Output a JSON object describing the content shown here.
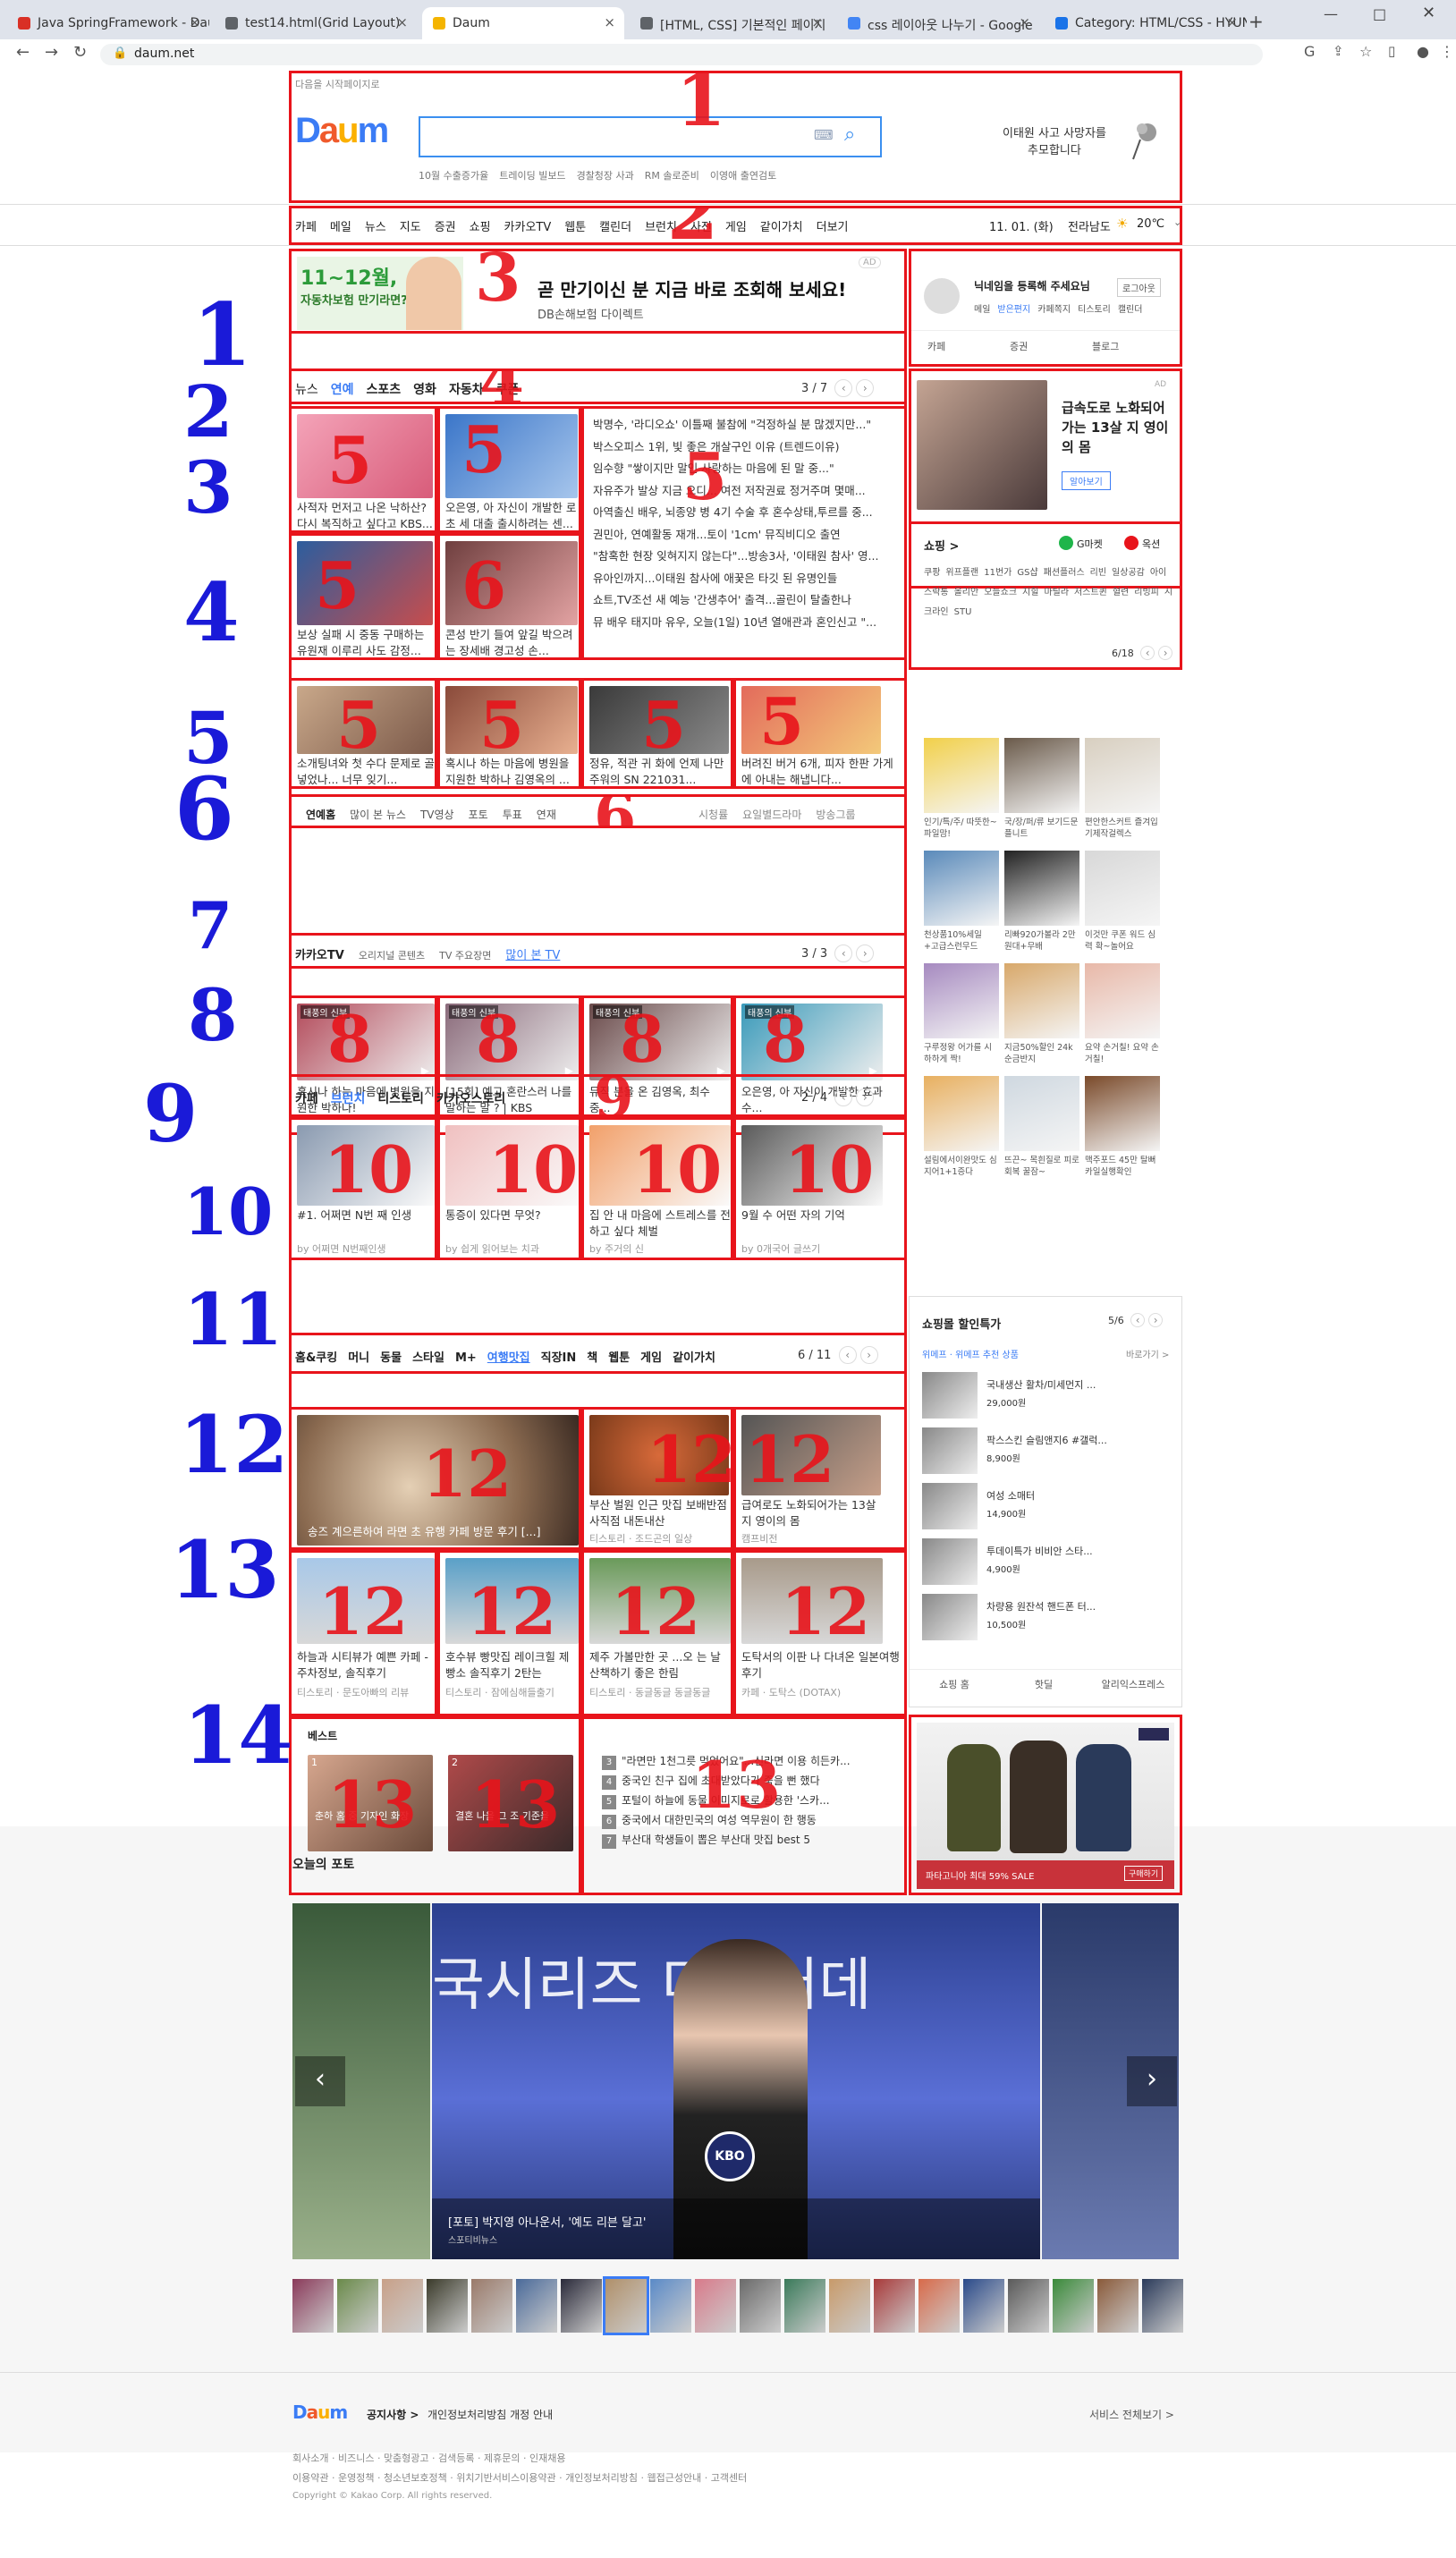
{
  "browser": {
    "tabs": [
      {
        "title": "Java SpringFramework - Daum",
        "color": "#d93025"
      },
      {
        "title": "test14.html(Grid Layout)",
        "color": "#5f6368"
      },
      {
        "title": "Daum",
        "color": "#f4b400"
      },
      {
        "title": "[HTML, CSS] 기본적인 페이지",
        "color": "#5f6368"
      },
      {
        "title": "css 레이아웃 나누기 - Google",
        "color": "#4285f4"
      },
      {
        "title": "Category: HTML/CSS - HYUN",
        "color": "#1a73e8"
      }
    ],
    "url": "daum.net",
    "new_tab": "+"
  },
  "header": {
    "start_link": "다음을 시작페이지로",
    "logo": "Daum",
    "trending": [
      "10월 수출증가율",
      "트레이딩 빌보드",
      "경찰청장 사과",
      "RM 솔로준비",
      "이영애 출연검토"
    ],
    "memorial": [
      "이태원 사고 사망자를",
      "추모합니다"
    ]
  },
  "gnb": {
    "items": [
      "카페",
      "메일",
      "뉴스",
      "지도",
      "증권",
      "쇼핑",
      "카카오TV",
      "웹툰",
      "캘린더",
      "브런치",
      "사전",
      "게임",
      "같이가치",
      "더보기"
    ],
    "date": "11. 01. (화)",
    "region": "전라남도",
    "temp": "20℃"
  },
  "ad_banner": {
    "badge_line1": "11~12월,",
    "badge_line2": "자동차보험 만기라면?",
    "title": "곧 만기이신 분 지금 바로 조회해 보세요!",
    "sub": "DB손해보험 다이렉트",
    "ad": "AD"
  },
  "news_tabs": {
    "items": [
      "뉴스",
      "연예",
      "스포츠",
      "영화",
      "자동차",
      "쿠폰"
    ],
    "page": "3 / 7"
  },
  "news_cards_row1": [
    {
      "text": "사적자 먼저고 나온 낙하산? 다시 복직하고 싶다고 KBS..."
    },
    {
      "text": "오은영, 아 자신이 개발한 로 초 세 대출 출시하려는 센..."
    }
  ],
  "news_cards_row2": [
    {
      "text": "보상 실패 시 중동 구매하는 유원재 이루리 사도 감정..."
    },
    {
      "text": "콘성 반기 들여 앞길 박으려는 장세배 경고성 손..."
    }
  ],
  "news_list": [
    "박명수, '라디오쇼' 이틀째 불참에 \"걱정하실 분 많겠지만...\"",
    "박스오피스 1위, 빛 좋은 개살구인 이유 (트렌드이유)",
    "임수향 \"쌓이지만 말인 사랑하는 마음에 된 말 중...\"",
    "자유주가 발상 지금 오디... 여전 저작권료 정거주며 몇매...",
    "아역출신 배우, 뇌종양 병 4기 수술 후 혼수상태,투르를 중...",
    "권민아, 연예활동 재개...토이 '1cm' 뮤직비디오 출연",
    "\"참혹한 현장 잊혀지지 않는다\"...방송3사, '이태원 참사' 영...",
    "유아인까지...이태원 참사에 애꿎은 타깃 된 유명인들",
    "쇼트,TV조선 새 예능 '간생추어' 출격...골린이 탈출한나",
    "뮤 배우 태지마 유우, 오늘(1일) 10년 열애관과 혼인신고 \"..."
  ],
  "news_cards_row3": [
    {
      "text": "소개팅녀와 첫 수다 문제로 골넣었나... 너무 잊기..."
    },
    {
      "text": "혹시나 하는 마음에 병원을 지원한 박하나 김영옥의 ..."
    },
    {
      "text": "정유, 적관 귀 화에 언제 나만 주워의 SN 221031..."
    },
    {
      "text": "버려진 버거 6개, 피자 한판 가게에 아내는 해냅니다..."
    }
  ],
  "ent_subtabs": {
    "items": [
      "연예홈",
      "많이 본 뉴스",
      "TV영상",
      "포토",
      "투표",
      "연재"
    ],
    "right": [
      "시청률",
      "요일별드라마",
      "방송그룹"
    ]
  },
  "kakaotv": {
    "tabs": [
      "카카오TV",
      "오리지널 콘텐츠",
      "TV 주요장면",
      "많이 본 TV"
    ],
    "page": "3 / 3",
    "cards": [
      {
        "tag": "태풍의 신부",
        "text": "혹시나 하는 마음에 병원을 지원한 박하나!"
      },
      {
        "tag": "태풍의 신부",
        "text": "[15회] 예고 혼란스러 나를 말하는 말 ? | KBS"
      },
      {
        "tag": "태풍의 신부",
        "text": "뮤직 분을 온 김영옥, 최수 중..."
      },
      {
        "tag": "태풍의 신부",
        "text": "오은영, 아 자신이 개발한 효과 수..."
      }
    ]
  },
  "cafe": {
    "tabs": [
      "카페",
      "브런치",
      "티스토리",
      "카카오스토리"
    ],
    "page": "2 / 4",
    "cards": [
      {
        "title": "#1. 어쩌면 N번 째 인생",
        "by": "by 어쩌면 N번째인생"
      },
      {
        "title": "통증이 있다면 무엇?",
        "by": "by 쉽게 읽어보는 치과"
      },
      {
        "title": "집 안 내 마음에 스트레스를 전하고 싶다 체벌",
        "by": "by 주거의 신"
      },
      {
        "title": "9월 수 어떤 자의 기억",
        "by": "by 0개국어 글쓰기"
      }
    ]
  },
  "life_tabs": {
    "items": [
      "홈&쿠킹",
      "머니",
      "동물",
      "스타일",
      "M+",
      "여행맛집",
      "직장IN",
      "책",
      "웹툰",
      "게임",
      "같이가치"
    ],
    "page": "6 / 11"
  },
  "life_row1": [
    {
      "text": "송즈 계으른하여 라면 초 유행 카페 방문 후기 [...]",
      "src": ""
    },
    {
      "text": "부산 벌원 인근 맛집 보배반점 사직점 내돈내산",
      "src": "티스토리 · 조드곤의 일상"
    },
    {
      "text": "급여로도 노화되어가는 13살 지 영이의 몸",
      "src": "캠프비전"
    }
  ],
  "life_row2": [
    {
      "text": "하늘과 시티뷰가 예쁜 카페 - 주차정보, 솔직후기",
      "src": "티스토리 · 문도아빠의 리뷰"
    },
    {
      "text": "호수뷰 빵맛집 레이크힐 제빵소 솔직후기 2탄는",
      "src": "티스토리 · 잠에심해들출기"
    },
    {
      "text": "제주 가볼만한 곳 ...오 는 날 산책하기 좋은 한림",
      "src": "티스토리 · 동글동글 동글동글"
    },
    {
      "text": "도탁서의 이판 나 다녀온 일본여행 후기",
      "src": "카페 · 도탁스 (DOTAX)"
    }
  ],
  "best": {
    "title": "베스트",
    "thumbs": [
      {
        "rank": "1",
        "text": "춘하 홈 중 기자인 화장"
      },
      {
        "rank": "2",
        "text": "결혼 나을 그 조 기준을"
      }
    ],
    "list": [
      {
        "rank": "3",
        "text": "\"라면만 1천그릇 먹었어요\"...신라면 이용 히든카..."
      },
      {
        "rank": "4",
        "text": "중국인 친구 집에 초대받았다가 죽을 뻔 했다"
      },
      {
        "rank": "5",
        "text": "포털이 하늘에 동물 이미지로로 활용한 '스카..."
      },
      {
        "rank": "6",
        "text": "중국에서 대한민국의 여성 역무원이 한 행동"
      },
      {
        "rank": "7",
        "text": "부산대 학생들이 뽑은 부산대 맛집 best 5"
      }
    ]
  },
  "login": {
    "title": "닉네임을 등록해 주세요님",
    "login_btn": "로그아웃",
    "links": [
      "메일",
      "받은편지",
      "카페쪽지",
      "티스토리",
      "캘린더"
    ],
    "shortcuts": [
      "카페",
      "증권",
      "블로그"
    ]
  },
  "side_ad": {
    "text": "급속도로 노화되어가는 13살 지 영이의 몸",
    "btn": "알아보기",
    "ad": "AD"
  },
  "shopping": {
    "title": "쇼핑 >",
    "brands": [
      "G마켓",
      "옥션"
    ],
    "keywords": [
      "쿠팡",
      "위프플랜",
      "11번가",
      "GS샵",
      "패션플러스",
      "리빈",
      "일상공감",
      "아이스락통",
      "올리안",
      "오늘쇼크",
      "지힐",
      "마틸라",
      "저스트퀸",
      "혈련",
      "리빙피",
      "시크라인",
      "STU"
    ],
    "page": "6/18",
    "grid": [
      "인기/특/주/ 따뜻한~파일맘!",
      "국/장/퍼/류 보기드문 플니트",
      "편안한스커트 즐겨입기제작걸렉스",
      "천상품10%세일 +고급스런무드",
      "리빠920가볼라 2만원대+무배",
      "이것만 쿠폰 워드 심력 확~놀어요",
      "구루정왕 어가를 시하하게 짝!",
      "지금50%할인 24k순금반지",
      "요약 손거칠! 요약 손거칠!",
      "설림에서이완맛도 심지어1+1증다",
      "뜨끈~ 목흰질로 피로회복 꿀잠~",
      "맥주포드 45만 탈뻐카일실행확인"
    ]
  },
  "mall_sale": {
    "title": "쇼핑몰 할인특가",
    "page": "5/6",
    "sub": "위메프 · 위메프 추천 상품",
    "sub_right": "바로가기 >",
    "items": [
      {
        "name": "국내생산 활차/미세먼지 ...",
        "price": "29,000원"
      },
      {
        "name": "팍스스킨 슬림앤지6 #갤럭...",
        "price": "8,900원"
      },
      {
        "name": "여성 소매터",
        "price": "14,900원"
      },
      {
        "name": "투데이특가 비비안 스타...",
        "price": "4,900원"
      },
      {
        "name": "차량용 원잔석 핸드폰 터...",
        "price": "10,500원"
      }
    ],
    "tabs": [
      "쇼핑 홈",
      "핫딜",
      "알리익스프레스"
    ]
  },
  "patagonia_ad": {
    "text": "파타고니아 최대 59% SALE",
    "btn": "구매하기"
  },
  "photo": {
    "title": "오늘의 포토",
    "caption": "[포토] 박지영 아나운서, '예도 리븐 달고'",
    "source": "스포티비뉴스",
    "banner_text": "국시리즈 미디어데",
    "mic": "KBO"
  },
  "footer": {
    "logo": "Daum",
    "notice_label": "공지사항 >",
    "notice": "개인정보처리방침 개정 안내",
    "service_all": "서비스 전체보기 >",
    "links1": "회사소개 · 비즈니스 · 맞춤형광고 · 검색등록 · 제휴문의 · 인재채용",
    "links2": "이용약관 · 운영정책 · 청소년보호정책 · 위치기반서비스이용약관 · 개인정보처리방침 · 웹접근성안내 · 고객센터",
    "copyright": "Copyright © Kakao Corp. All rights reserved."
  },
  "annotations": {
    "red_numbers": [
      "1",
      "2",
      "3",
      "4",
      "5",
      "5",
      "5",
      "5",
      "6",
      "6",
      "5",
      "5",
      "5",
      "5",
      "6",
      "8",
      "8",
      "8",
      "8",
      "9",
      "10",
      "10",
      "10",
      "10",
      "11",
      "12",
      "12",
      "12",
      "12",
      "12",
      "12",
      "12",
      "13",
      "13",
      "13"
    ],
    "blue_numbers": [
      "1",
      "2",
      "3",
      "4",
      "5",
      "6",
      "7",
      "8",
      "9",
      "10",
      "11",
      "12",
      "13",
      "14"
    ]
  },
  "colors": {
    "red": "#e8141b",
    "blue": "#1a1ad8",
    "daum_blue": "#3b7cf5",
    "search_border": "#3b8ff0"
  }
}
